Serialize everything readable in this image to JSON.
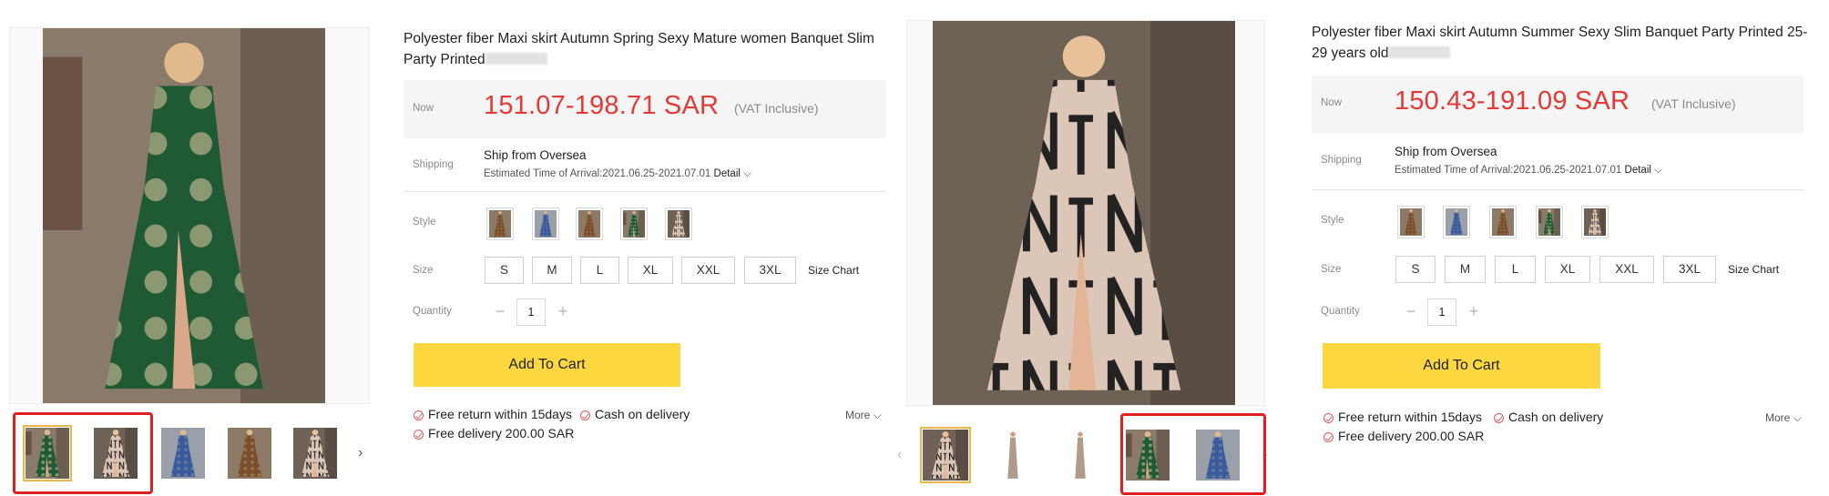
{
  "products": [
    {
      "title": "Polyester fiber Maxi skirt Autumn Spring Sexy Mature women Banquet Slim Party Printed",
      "price_label": "Now",
      "price": "151.07-198.71 SAR",
      "vat": "(VAT Inclusive)",
      "shipping_label": "Shipping",
      "shipping_from": "Ship from Oversea",
      "eta": "Estimated Time of Arrival:2021.06.25-2021.07.01",
      "detail": "Detail",
      "style_label": "Style",
      "size_label": "Size",
      "sizes": [
        "S",
        "M",
        "L",
        "XL",
        "XXL",
        "3XL"
      ],
      "size_chart": "Size Chart",
      "quantity_label": "Quantity",
      "quantity": "1",
      "add_to_cart": "Add To Cart",
      "features": [
        "Free return within 15days",
        "Cash on delivery",
        "Free delivery 200.00 SAR"
      ],
      "more": "More"
    },
    {
      "title": "Polyester fiber Maxi skirt Autumn Summer Sexy Slim Banquet Party Printed 25-29 years old",
      "price_label": "Now",
      "price": "150.43-191.09 SAR",
      "vat": "(VAT Inclusive)",
      "shipping_label": "Shipping",
      "shipping_from": "Ship from Oversea",
      "eta": "Estimated Time of Arrival:2021.06.25-2021.07.01",
      "detail": "Detail",
      "style_label": "Style",
      "size_label": "Size",
      "sizes": [
        "S",
        "M",
        "L",
        "XL",
        "XXL",
        "3XL"
      ],
      "size_chart": "Size Chart",
      "quantity_label": "Quantity",
      "quantity": "1",
      "add_to_cart": "Add To Cart",
      "features": [
        "Free return within 15days",
        "Cash on delivery",
        "Free delivery 200.00 SAR"
      ],
      "more": "More"
    }
  ],
  "icons": {
    "next_arrow": "›",
    "prev_arrow": "‹",
    "chevron_down": "⌵",
    "minus": "−",
    "plus": "+"
  },
  "colors": {
    "price": "#e53935",
    "cart_button": "#fcd73f",
    "highlight_box": "#e02020",
    "selected_thumb": "#e8b84a"
  }
}
